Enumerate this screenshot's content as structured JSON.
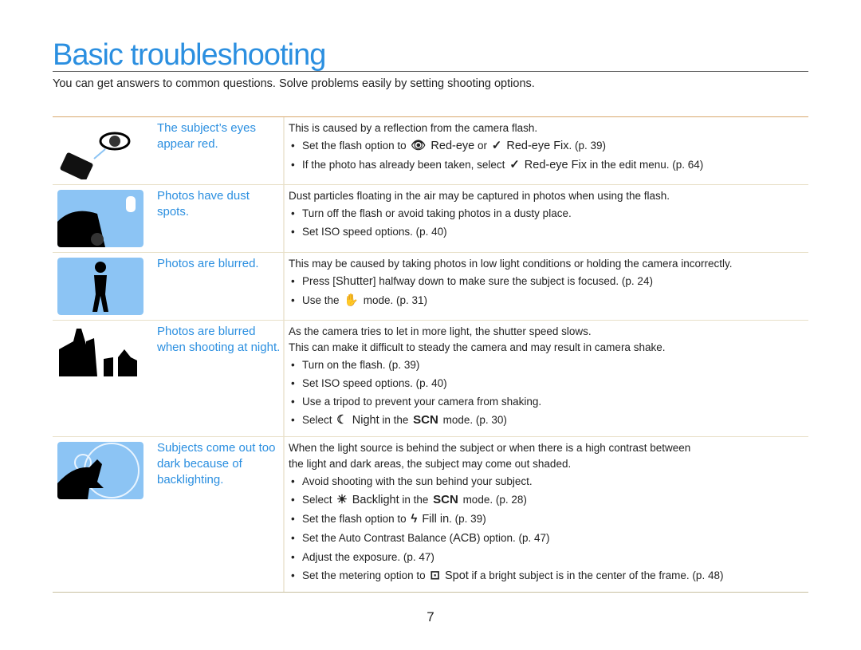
{
  "title": "Basic troubleshooting",
  "intro": "You can get answers to common questions. Solve problems easily by setting shooting options.",
  "page_number": "7",
  "rows": [
    {
      "label": "The subject’s eyes appear red.",
      "image": "red-eye-camera",
      "desc": [
        "This is caused by a reflection from the camera flash."
      ],
      "bullets": [
        [
          {
            "t": "Set the flash option to "
          },
          {
            "i": "red-eye-icon",
            "g": "👁"
          },
          {
            "h": " Red-eye"
          },
          {
            "t": " or "
          },
          {
            "i": "red-eye-fix-icon",
            "g": "✓"
          },
          {
            "h": " Red-eye Fix"
          },
          {
            "t": ". (p. 39)"
          }
        ],
        [
          {
            "t": "If the photo has already been taken, select "
          },
          {
            "i": "red-eye-fix-icon",
            "g": "✓"
          },
          {
            "h": " Red-eye Fix"
          },
          {
            "t": " in the edit menu. (p. 64)"
          }
        ]
      ]
    },
    {
      "label": "Photos have dust spots.",
      "image": "dust-spots",
      "desc": [
        "Dust particles floating in the air may be captured in photos when using the flash."
      ],
      "bullets": [
        [
          {
            "t": "Turn off the flash or avoid taking photos in a dusty place."
          }
        ],
        [
          {
            "t": "Set ISO speed options. (p. 40)"
          }
        ]
      ]
    },
    {
      "label": "Photos are blurred.",
      "image": "blurred-person",
      "desc": [
        "This may be caused by taking photos in low light conditions or holding the camera incorrectly."
      ],
      "bullets": [
        [
          {
            "t": "Press ["
          },
          {
            "h": "Shutter"
          },
          {
            "t": "] halfway down to make sure the subject is focused. (p. 24)"
          }
        ],
        [
          {
            "t": "Use the "
          },
          {
            "i": "dual-is-icon",
            "g": "✋"
          },
          {
            "t": " mode. (p. 31)"
          }
        ]
      ]
    },
    {
      "label": "Photos are blurred when shooting at night.",
      "image": "night-city",
      "desc": [
        "As the camera tries to let in more light, the shutter speed slows.",
        "This can make it difficult to steady the camera and may result in camera shake."
      ],
      "bullets": [
        [
          {
            "t": "Turn on the flash. (p. 39)"
          }
        ],
        [
          {
            "t": "Set ISO speed options. (p. 40)"
          }
        ],
        [
          {
            "t": "Use a tripod to prevent your camera from shaking."
          }
        ],
        [
          {
            "t": "Select "
          },
          {
            "i": "night-icon",
            "g": "☾"
          },
          {
            "h": " Night"
          },
          {
            "t": " in the "
          },
          {
            "i": "scene-mode-icon",
            "g": "SCN"
          },
          {
            "t": " mode. (p. 30)"
          }
        ]
      ]
    },
    {
      "label": "Subjects come out too dark because of backlighting.",
      "image": "backlit-person",
      "desc": [
        "When the light source is behind the subject or when there is a high contrast between",
        "the light and dark areas, the subject may come out shaded."
      ],
      "bullets": [
        [
          {
            "t": "Avoid shooting with the sun behind your subject."
          }
        ],
        [
          {
            "t": "Select "
          },
          {
            "i": "backlight-icon",
            "g": "☀"
          },
          {
            "h": " Backlight"
          },
          {
            "t": " in the "
          },
          {
            "i": "scene-mode-icon",
            "g": "SCN"
          },
          {
            "t": " mode. (p. 28)"
          }
        ],
        [
          {
            "t": "Set the flash option to "
          },
          {
            "i": "fill-in-flash-icon",
            "g": "ϟ"
          },
          {
            "h": " Fill in"
          },
          {
            "t": ". (p. 39)"
          }
        ],
        [
          {
            "t": "Set the Auto Contrast Balance ("
          },
          {
            "h": "ACB"
          },
          {
            "t": ") option. (p. 47)"
          }
        ],
        [
          {
            "t": "Adjust the exposure. (p. 47)"
          }
        ],
        [
          {
            "t": "Set the metering option to "
          },
          {
            "i": "spot-metering-icon",
            "g": "⊡"
          },
          {
            "h": " Spot"
          },
          {
            "t": " if a bright subject is in the center of the frame. (p. 48)"
          }
        ]
      ]
    }
  ]
}
